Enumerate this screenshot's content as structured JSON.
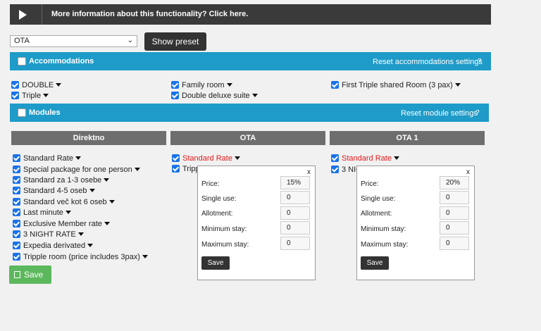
{
  "info_bar": {
    "text": "More information about this functionality? Click here."
  },
  "preset": {
    "selected": "OTA",
    "button": "Show preset"
  },
  "accommodations": {
    "title": "Accommodations",
    "reset": "Reset accommodations settings",
    "help": "?",
    "items": [
      "DOUBLE",
      "Triple",
      "Family room",
      "Double deluxe suite",
      "First Triple shared Room (3 pax)"
    ]
  },
  "modules": {
    "title": "Modules",
    "reset": "Reset module settings",
    "help": "?"
  },
  "columns": [
    {
      "title": "Direktno",
      "rates": [
        "Standard Rate",
        "Special package for one person",
        "Standard za 1-3 osebe",
        "Standard 4-5 oseb",
        "Standard več kot 6 oseb",
        "Last minute",
        "Exclusive Member rate",
        "3 NIGHT RATE",
        "Expedia derivated",
        "Tripple room (price includes 3pax)"
      ]
    },
    {
      "title": "OTA",
      "rates": [
        "Standard Rate",
        "Tripp"
      ]
    },
    {
      "title": "OTA 1",
      "rates": [
        "Standard Rate",
        "3 NIG"
      ]
    }
  ],
  "popups": [
    {
      "close": "x",
      "labels": [
        "Price:",
        "Single use:",
        "Allotment:",
        "Minimum stay:",
        "Maximum stay:"
      ],
      "values": [
        "15%",
        "0",
        "0",
        "0",
        "0"
      ],
      "save": "Save"
    },
    {
      "close": "x",
      "labels": [
        "Price:",
        "Single use:",
        "Allotment:",
        "Minimum stay:",
        "Maximum stay:"
      ],
      "values": [
        "20%",
        "0",
        "0",
        "0",
        "0"
      ],
      "save": "Save"
    }
  ],
  "save_button": "Save",
  "colors": {
    "accent": "#1e9bc8",
    "header_dark": "#3a3a3a",
    "column_header": "#6e6e6e",
    "save_green": "#5cb85c",
    "rate_red": "#e21a1a"
  }
}
